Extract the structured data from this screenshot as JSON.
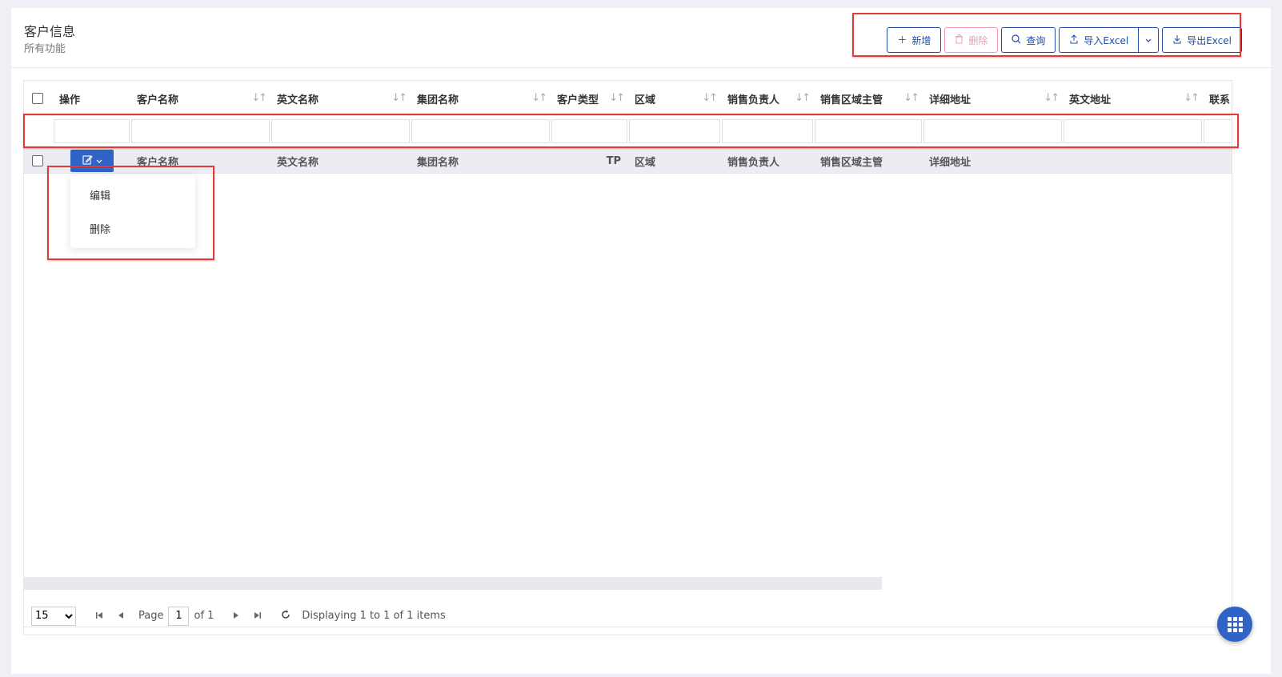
{
  "page": {
    "title": "客户信息",
    "subtitle": "所有功能"
  },
  "toolbar": {
    "add_label": "新增",
    "delete_label": "删除",
    "query_label": "查询",
    "import_label": "导入Excel",
    "export_label": "导出Excel"
  },
  "columns": [
    {
      "key": "op",
      "label": "操作"
    },
    {
      "key": "customer_name",
      "label": "客户名称"
    },
    {
      "key": "english_name",
      "label": "英文名称"
    },
    {
      "key": "group_name",
      "label": "集团名称"
    },
    {
      "key": "customer_type",
      "label": "客户类型"
    },
    {
      "key": "region",
      "label": "区域"
    },
    {
      "key": "sales_owner",
      "label": "销售负责人"
    },
    {
      "key": "sales_region_manager",
      "label": "销售区域主管"
    },
    {
      "key": "address",
      "label": "详细地址"
    },
    {
      "key": "english_address",
      "label": "英文地址"
    },
    {
      "key": "contact",
      "label": "联系"
    }
  ],
  "row": {
    "customer_name": "客户名称",
    "english_name": "英文名称",
    "group_name": "集团名称",
    "customer_type": "TP",
    "region": "区域",
    "sales_owner": "销售负责人",
    "sales_region_manager": "销售区域主管",
    "address": "详细地址"
  },
  "row_menu": {
    "edit": "编辑",
    "delete": "删除"
  },
  "pager": {
    "page_size": "15",
    "page_label": "Page",
    "page_value": "1",
    "of_label": "of 1",
    "info": "Displaying 1 to 1 of 1 items"
  },
  "colors": {
    "primary": "#2f63c6",
    "danger": "#f39bb2",
    "highlight": "#e53935"
  }
}
